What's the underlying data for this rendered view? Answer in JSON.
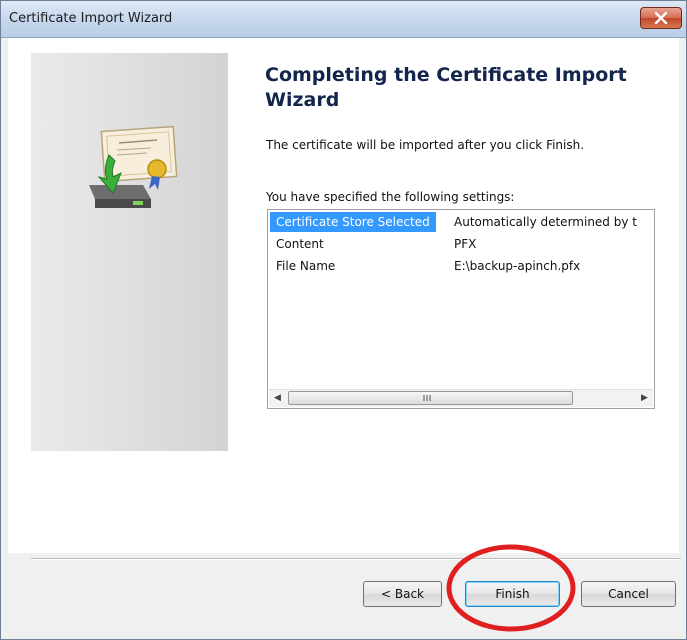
{
  "window": {
    "title": "Certificate Import Wizard"
  },
  "page": {
    "heading": "Completing the Certificate Import Wizard",
    "description": "The certificate will be imported after you click Finish.",
    "settings_label": "You have specified the following settings:"
  },
  "settings": {
    "rows": [
      {
        "name": "Certificate Store Selected",
        "value": "Automatically determined by t"
      },
      {
        "name": "Content",
        "value": "PFX"
      },
      {
        "name": "File Name",
        "value": "E:\\backup-apinch.pfx"
      }
    ],
    "scrollbar_grip": "III"
  },
  "buttons": {
    "back": "< Back",
    "finish": "Finish",
    "cancel": "Cancel"
  },
  "colors": {
    "selection": "#3399ff",
    "annotation": "#e02020",
    "heading": "#13254d"
  },
  "icons": {
    "close": "close-x-icon",
    "wizard": "certificate-install-icon"
  }
}
